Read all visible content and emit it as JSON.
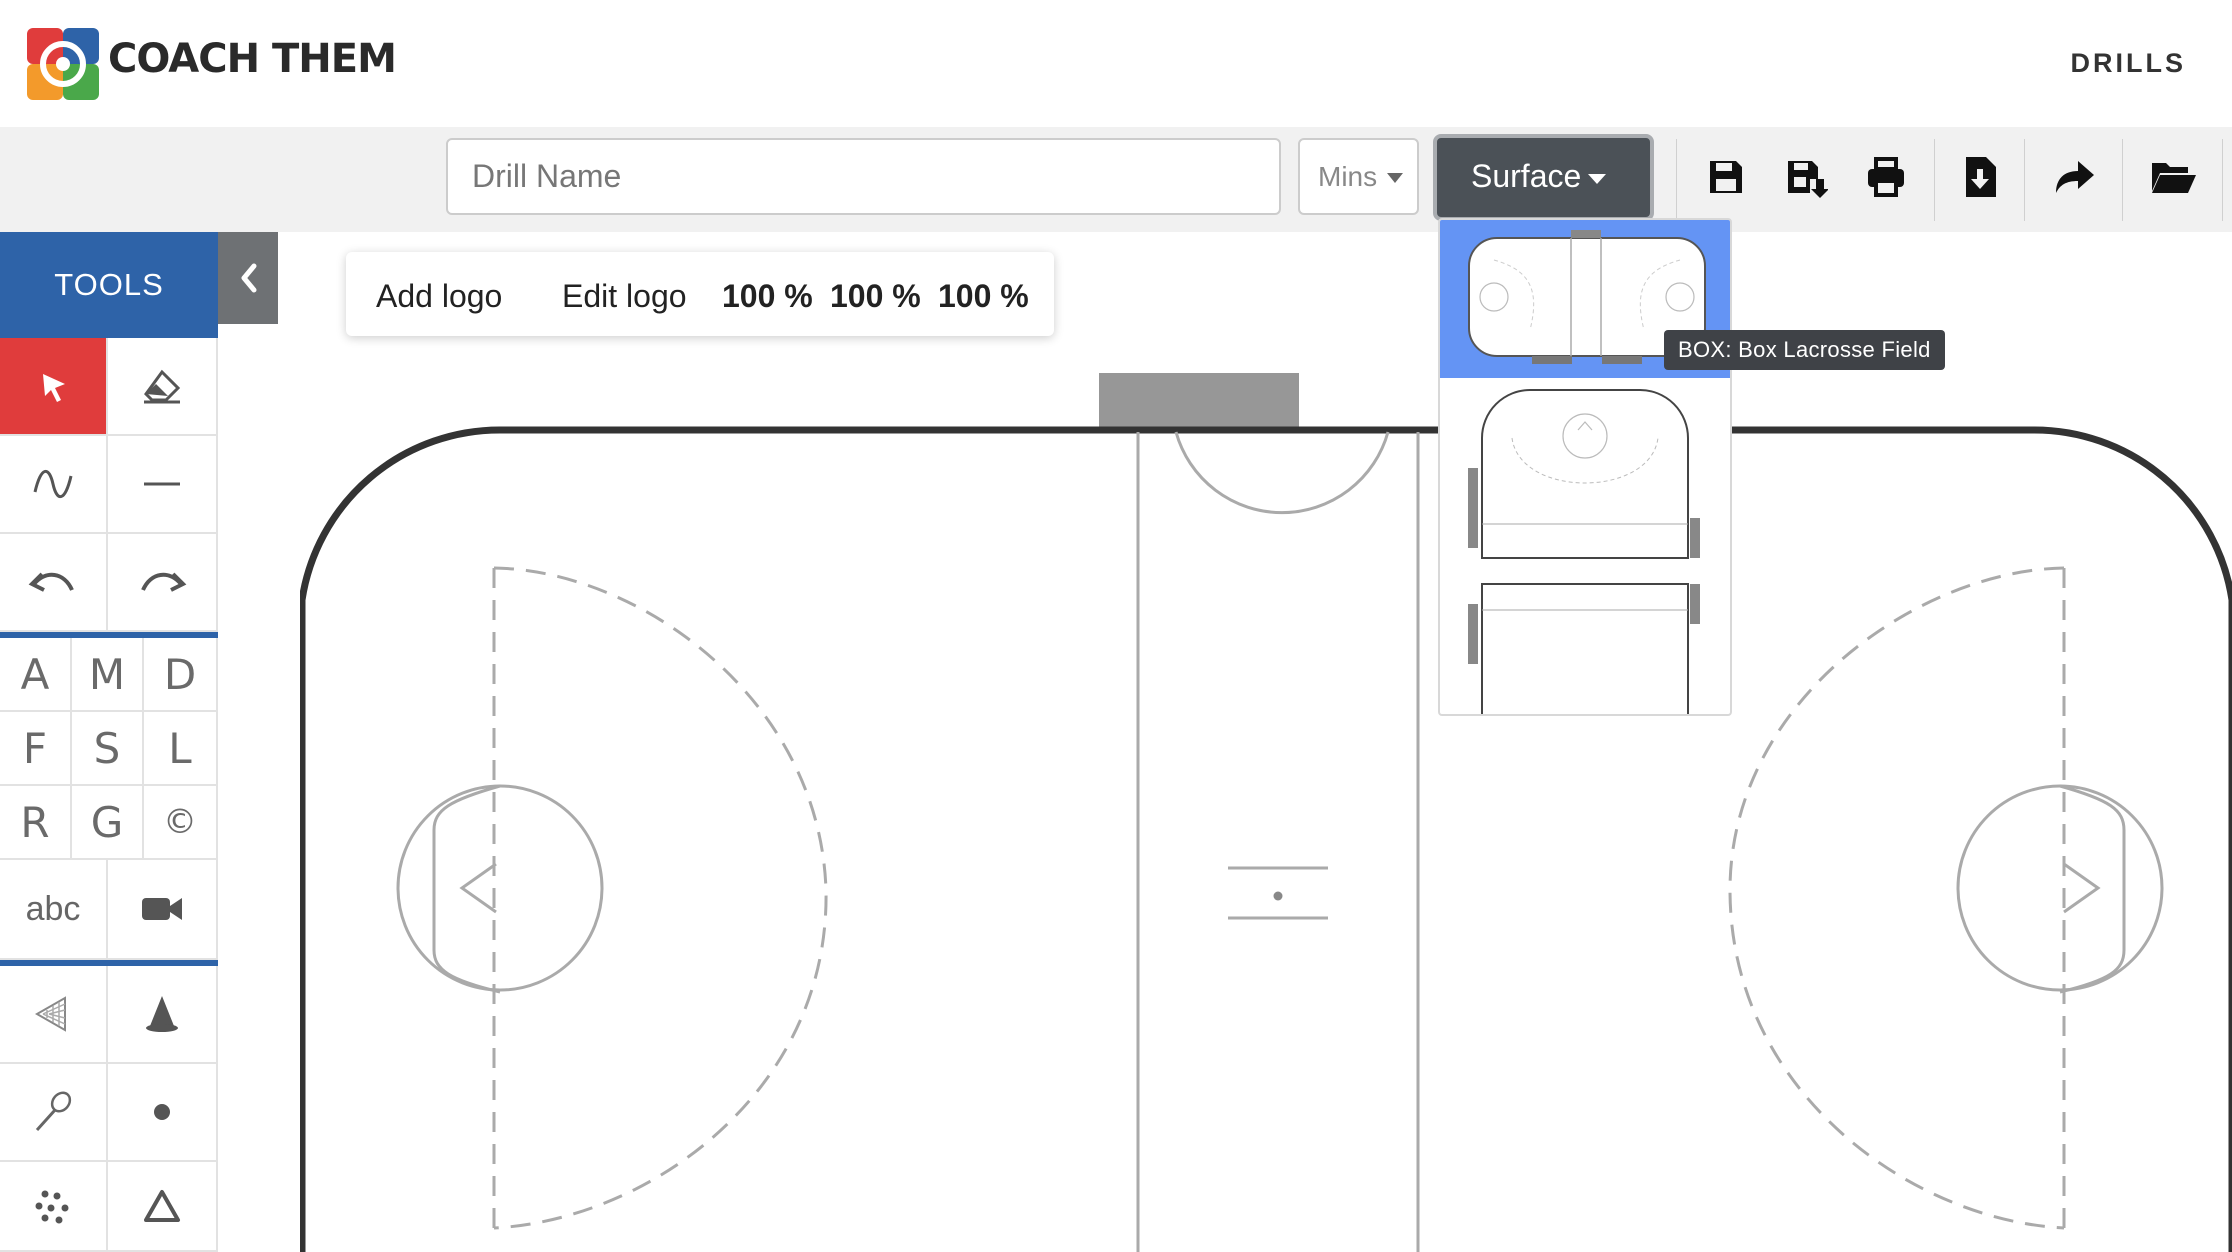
{
  "header": {
    "brand": "COACH THEM",
    "nav_drills": "DRILLS"
  },
  "toolbar": {
    "drill_name_placeholder": "Drill Name",
    "drill_name_value": "",
    "mins_placeholder": "Mins",
    "surface_label": "Surface",
    "icons": [
      "save-icon",
      "save-as-icon",
      "print-icon",
      "download-icon",
      "share-icon",
      "open-folder-icon"
    ]
  },
  "tools": {
    "title": "TOOLS",
    "letters": [
      "A",
      "M",
      "D",
      "F",
      "S",
      "L",
      "R",
      "G",
      "©"
    ],
    "text_tool": "abc"
  },
  "logo_bar": {
    "add_logo": "Add logo",
    "edit_logo": "Edit logo",
    "scale_1": "100 %",
    "scale_2": "100 %",
    "scale_3": "100 %"
  },
  "surface_dropdown": {
    "options": [
      "box-lacrosse-field",
      "half-field",
      "field-end"
    ],
    "selected_index": 0
  },
  "tooltip": "BOX: Box Lacrosse Field",
  "colors": {
    "accent_blue": "#2e63a8",
    "active_red": "#e03c3c",
    "selected_blue": "#6494f4",
    "button_dark": "#4b5157"
  }
}
